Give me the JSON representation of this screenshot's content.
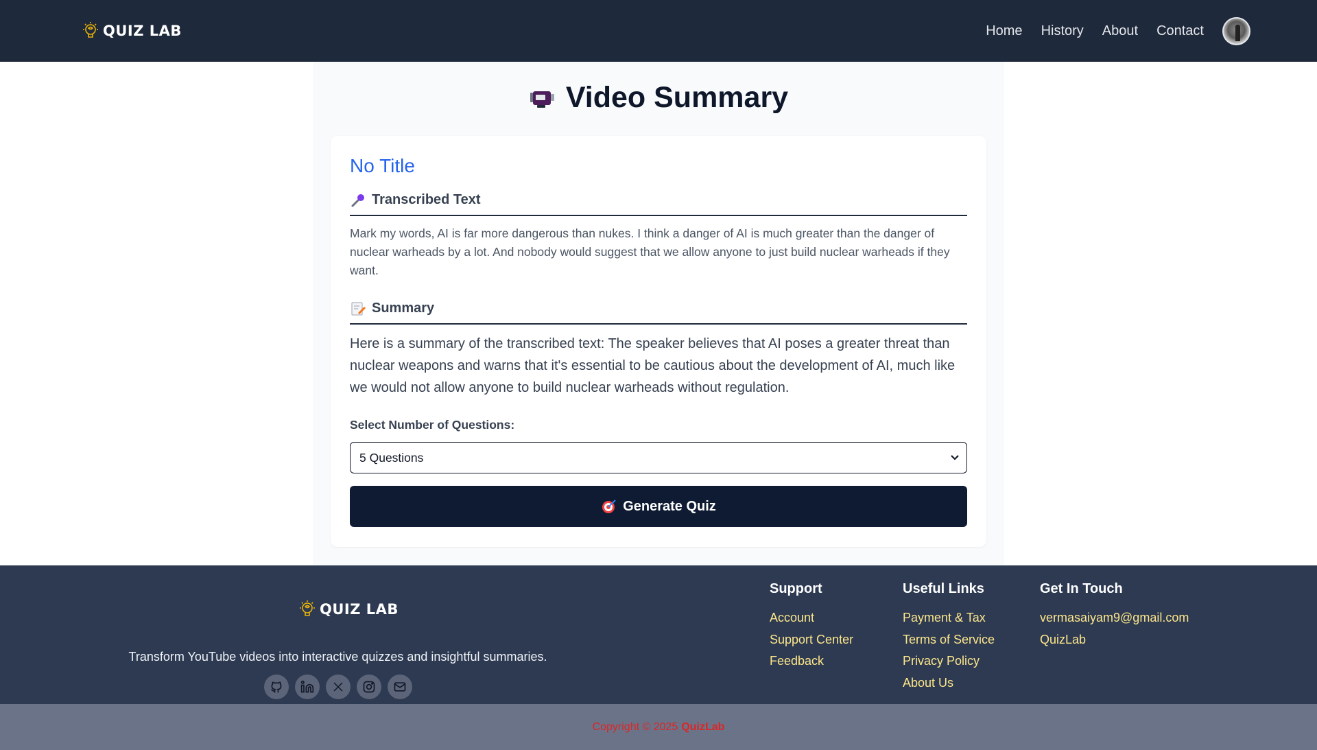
{
  "header": {
    "brand": "QUIZ LAB",
    "nav": [
      "Home",
      "History",
      "About",
      "Contact"
    ]
  },
  "main": {
    "page_title": "Video Summary",
    "video_title": "No Title",
    "transcribed_heading": "Transcribed Text",
    "transcribed_text": "Mark my words, AI is far more dangerous than nukes. I think a danger of AI is much greater than the danger of nuclear warheads by a lot. And nobody would suggest that we allow anyone to just build nuclear warheads if they want.",
    "summary_heading": "Summary",
    "summary_text": "Here is a summary of the transcribed text: The speaker believes that AI poses a greater threat than nuclear weapons and warns that it's essential to be cautious about the development of AI, much like we would not allow anyone to build nuclear warheads without regulation.",
    "select_label": "Select Number of Questions:",
    "select_value": "5 Questions",
    "generate_button": "Generate Quiz"
  },
  "footer": {
    "brand": "QUIZ LAB",
    "tagline": "Transform YouTube videos into interactive quizzes and insightful summaries.",
    "socials": [
      "github-icon",
      "linkedin-icon",
      "x-icon",
      "instagram-icon",
      "mail-icon"
    ],
    "support": {
      "heading": "Support",
      "links": [
        "Account",
        "Support Center",
        "Feedback"
      ]
    },
    "useful": {
      "heading": "Useful Links",
      "links": [
        "Payment & Tax",
        "Terms of Service",
        "Privacy Policy",
        "About Us"
      ]
    },
    "contact": {
      "heading": "Get In Touch",
      "links": [
        "vermasaiyam9@gmail.com",
        "QuizLab"
      ]
    },
    "copyright_prefix": "Copyright © 2025",
    "copyright_brand": "QuizLab"
  },
  "colors": {
    "header_bg": "#1e293b",
    "footer_bg": "#2d3a52",
    "accent_blue": "#2563eb",
    "button_bg": "#0f1b33",
    "footer_link": "#fde68a",
    "copyright_red": "#dc2626"
  }
}
